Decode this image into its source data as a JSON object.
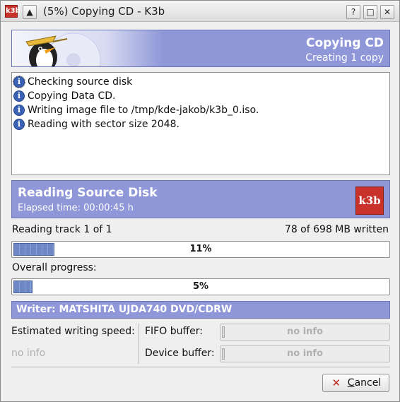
{
  "window": {
    "title": "(5%) Copying CD - K3b",
    "help_button": "?",
    "maximize_button": "□",
    "close_button": "✕",
    "shade_button": "▲",
    "app_icon_text": "k3b"
  },
  "header": {
    "title": "Copying CD",
    "subtitle": "Creating 1 copy"
  },
  "log": {
    "info_icon": "info-icon",
    "entries": [
      "Checking source disk",
      "Copying Data CD.",
      "Writing image file to /tmp/kde-jakob/k3b_0.iso.",
      "Reading with sector size 2048."
    ]
  },
  "job": {
    "title": "Reading Source Disk",
    "elapsed": "Elapsed time: 00:00:45 h",
    "logo_text": "k3b"
  },
  "track": {
    "label": "Reading track 1 of 1",
    "written": "78 of 698 MB written",
    "progress_percent": 11,
    "progress_text": "11%"
  },
  "overall": {
    "label": "Overall progress:",
    "progress_percent": 5,
    "progress_text": "5%"
  },
  "writer": {
    "label": "Writer: MATSHITA UJDA740 DVD/CDRW"
  },
  "speed": {
    "label": "Estimated writing speed:",
    "value": "no info"
  },
  "buffers": {
    "fifo_label": "FIFO buffer:",
    "fifo_value": "no info",
    "device_label": "Device buffer:",
    "device_value": "no info"
  },
  "actions": {
    "cancel_label": "Cancel",
    "cancel_icon": "cancel-icon"
  },
  "colors": {
    "accent": "#8f97d8",
    "progress": "#6d88c4",
    "brand": "#c8322a"
  }
}
